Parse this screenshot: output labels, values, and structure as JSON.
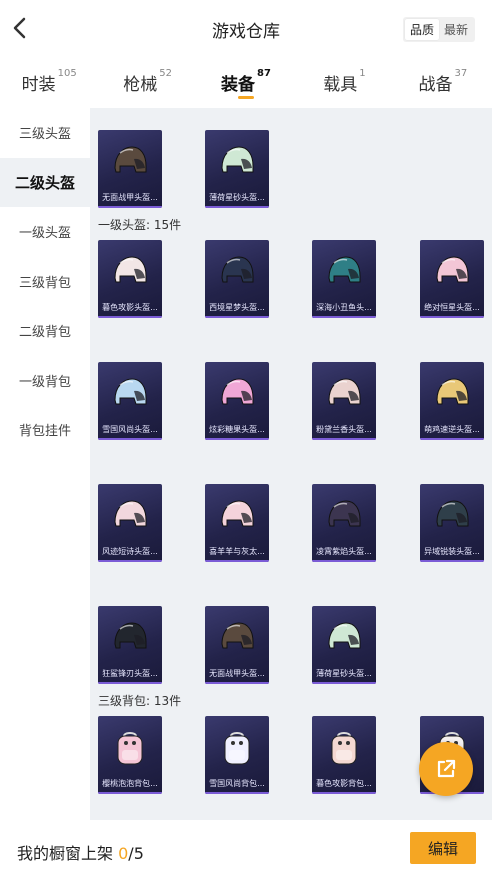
{
  "header": {
    "title": "游戏仓库",
    "sort_options": [
      "品质",
      "最新"
    ],
    "sort_selected": "品质"
  },
  "tabs": [
    {
      "label": "时装",
      "count": "105",
      "active": false
    },
    {
      "label": "枪械",
      "count": "52",
      "active": false
    },
    {
      "label": "装备",
      "count": "87",
      "active": true
    },
    {
      "label": "载具",
      "count": "1",
      "active": false
    },
    {
      "label": "战备",
      "count": "37",
      "active": false
    }
  ],
  "sidebar": {
    "items": [
      {
        "label": "三级头盔",
        "active": false
      },
      {
        "label": "二级头盔",
        "active": true
      },
      {
        "label": "一级头盔",
        "active": false
      },
      {
        "label": "三级背包",
        "active": false
      },
      {
        "label": "二级背包",
        "active": false
      },
      {
        "label": "一级背包",
        "active": false
      },
      {
        "label": "背包挂件",
        "active": false
      }
    ]
  },
  "sections": [
    {
      "label": "",
      "items": [
        {
          "name": "无面战甲头盔...",
          "icon": "helmet-icon",
          "color": "#5a4a3e"
        },
        {
          "name": "薄荷星砂头盔...",
          "icon": "helmet-icon",
          "color": "#cfe8d4"
        }
      ]
    },
    {
      "label": "一级头盔: 15件",
      "items": [
        {
          "name": "暮色攻影头盔...",
          "icon": "helmet-icon",
          "color": "#f2e6e6"
        },
        {
          "name": "西境星梦头盔...",
          "icon": "helmet-icon",
          "color": "#2a3550"
        },
        {
          "name": "深海小丑鱼头...",
          "icon": "helmet-icon",
          "color": "#2f7f86"
        },
        {
          "name": "绝对恒星头盔...",
          "icon": "helmet-icon",
          "color": "#f3c6d6"
        },
        {
          "name": "雪国风尚头盔...",
          "icon": "helmet-icon",
          "color": "#b9d8f0"
        },
        {
          "name": "炫彩糖果头盔...",
          "icon": "helmet-icon",
          "color": "#f0a7d6"
        },
        {
          "name": "粉黛兰香头盔...",
          "icon": "helmet-icon",
          "color": "#ead2cf"
        },
        {
          "name": "萌鸡速逆头盔...",
          "icon": "helmet-icon",
          "color": "#e9c878"
        },
        {
          "name": "风迹短诗头盔...",
          "icon": "helmet-icon",
          "color": "#f2d7dd"
        },
        {
          "name": "喜羊羊与灰太...",
          "icon": "helmet-icon",
          "color": "#f4d3db"
        },
        {
          "name": "凌霄紫焰头盔...",
          "icon": "helmet-icon",
          "color": "#3c3550"
        },
        {
          "name": "异域锐装头盔...",
          "icon": "helmet-icon",
          "color": "#2f3f4a"
        },
        {
          "name": "狂鲨锋刃头盔...",
          "icon": "helmet-icon",
          "color": "#22262e"
        },
        {
          "name": "无面战甲头盔...",
          "icon": "helmet-icon",
          "color": "#5a4a3e"
        },
        {
          "name": "薄荷星砂头盔...",
          "icon": "helmet-icon",
          "color": "#cfe8d4"
        }
      ]
    },
    {
      "label": "三级背包: 13件",
      "items": [
        {
          "name": "樱桃泡泡背包...",
          "icon": "backpack-icon",
          "color": "#f5c5d6"
        },
        {
          "name": "雪国风尚背包...",
          "icon": "backpack-icon",
          "color": "#f0f0ff"
        },
        {
          "name": "暮色攻影背包...",
          "icon": "backpack-icon",
          "color": "#f4d8d2"
        },
        {
          "name": "",
          "icon": "backpack-icon",
          "color": "#f5f0f0"
        }
      ]
    }
  ],
  "bottom_bar": {
    "text": "我的橱窗上架",
    "current": "0",
    "total": "/5",
    "edit_label": "编辑"
  },
  "fab": {
    "icon": "share-external-icon"
  }
}
